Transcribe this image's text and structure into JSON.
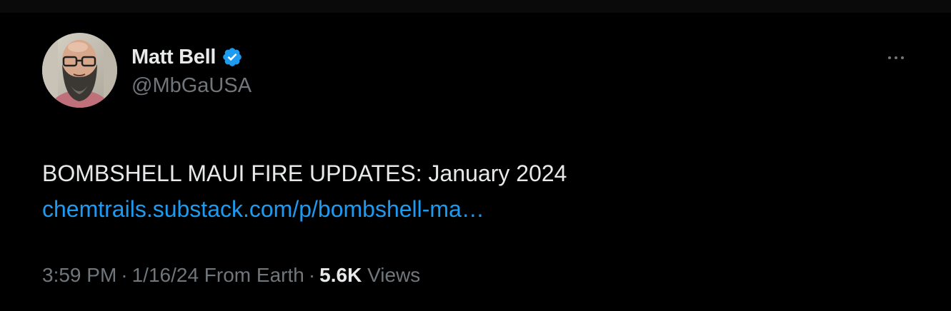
{
  "author": {
    "display_name": "Matt Bell",
    "handle": "@MbGaUSA",
    "verified": true,
    "verified_color": "#1d9bf0",
    "avatar_icon": "bearded-man-avatar"
  },
  "tweet": {
    "text": "BOMBSHELL MAUI FIRE UPDATES: January 2024",
    "link": "chemtrails.substack.com/p/bombshell-ma…",
    "link_color": "#1d9bf0"
  },
  "meta": {
    "time": "3:59 PM",
    "separator": "·",
    "date_source": "1/16/24 From Earth",
    "views_count": "5.6K",
    "views_label": "Views"
  },
  "icons": {
    "more": "more-options-icon",
    "verified": "verified-badge-icon"
  },
  "colors": {
    "background": "#000000",
    "text_primary": "#e7e9ea",
    "text_secondary": "#71767b"
  }
}
